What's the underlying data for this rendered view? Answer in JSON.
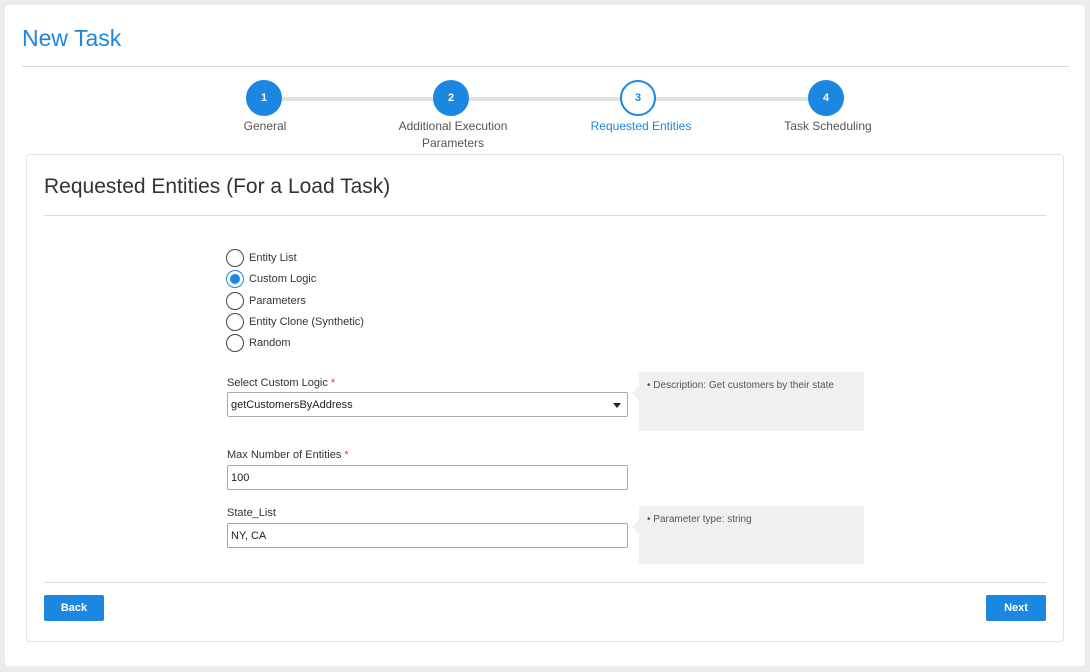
{
  "page": {
    "title": "New Task"
  },
  "steps": [
    {
      "number": "1",
      "label": "General",
      "state": "done"
    },
    {
      "number": "2",
      "label": "Additional Execution Parameters",
      "state": "done"
    },
    {
      "number": "3",
      "label": "Requested Entities",
      "state": "active"
    },
    {
      "number": "4",
      "label": "Task Scheduling",
      "state": "done"
    }
  ],
  "card": {
    "title": "Requested Entities (For a Load Task)"
  },
  "radio_options": [
    {
      "label": "Entity List",
      "checked": false
    },
    {
      "label": "Custom Logic",
      "checked": true
    },
    {
      "label": "Parameters",
      "checked": false
    },
    {
      "label": "Entity Clone (Synthetic)",
      "checked": false
    },
    {
      "label": "Random",
      "checked": false
    }
  ],
  "custom_logic": {
    "label": "Select Custom Logic",
    "required_mark": "*",
    "value": "getCustomersByAddress",
    "description": "• Description: Get customers by their state"
  },
  "max_entities": {
    "label": "Max Number of Entities",
    "required_mark": "*",
    "value": "100"
  },
  "state_list": {
    "label": "State_List",
    "value": "NY, CA",
    "param_type": "• Parameter type: string"
  },
  "buttons": {
    "back": "Back",
    "next": "Next"
  },
  "colors": {
    "accent": "#1c87e0",
    "required": "#e53935",
    "tooltip_bg": "#f0f0f0"
  }
}
